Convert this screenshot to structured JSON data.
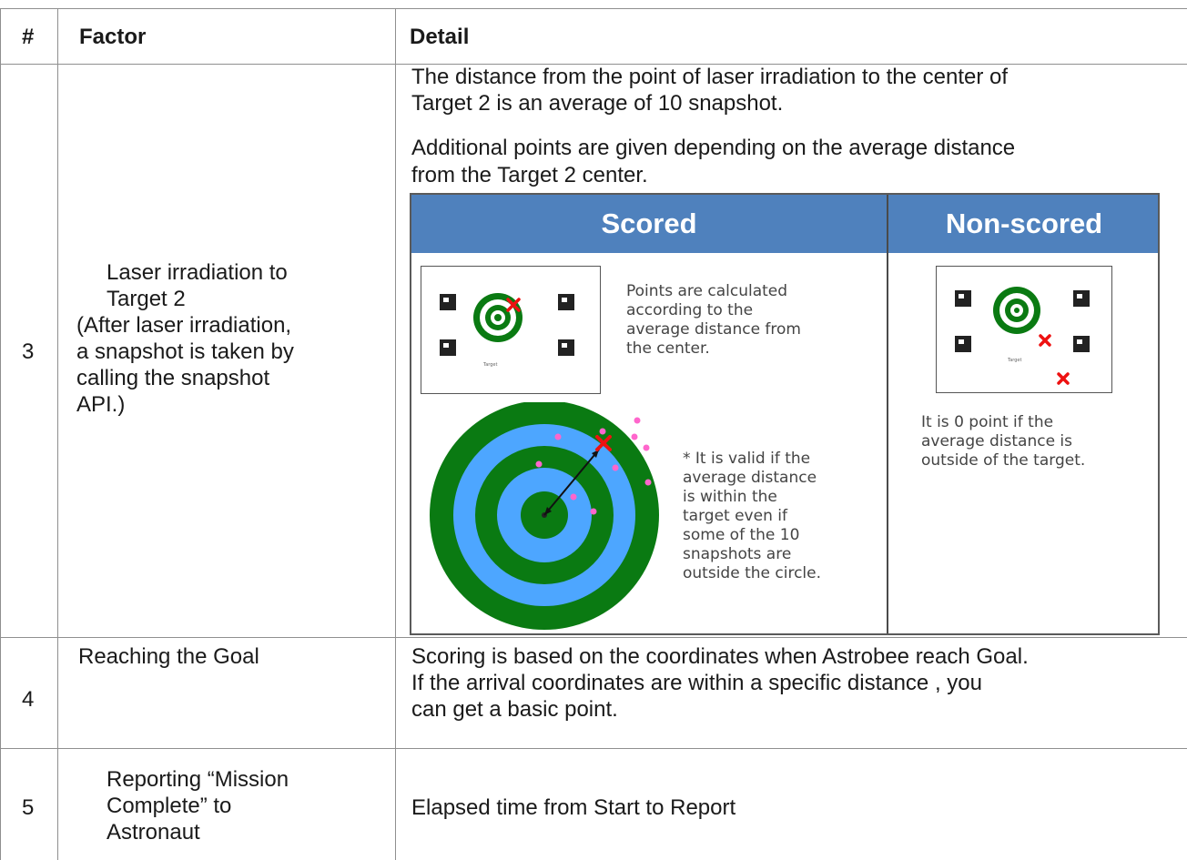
{
  "table": {
    "headers": {
      "num": "#",
      "factor": "Factor",
      "detail": "Detail"
    },
    "row3": {
      "num": "3",
      "factor_lines": [
        "Laser irradiation to",
        "Target 2",
        "(After laser irradiation,",
        "a snapshot is taken by",
        "calling the snapshot",
        "API.)"
      ],
      "detail_lines": [
        "The distance from the point of laser irradiation to the center of",
        "Target 2 is an average of 10 snapshot.",
        "Additional points are given depending on the average distance",
        "from the Target 2 center."
      ]
    },
    "row4": {
      "num": "4",
      "factor": "Reaching the Goal",
      "detail_lines": [
        "Scoring is based on the coordinates when Astrobee reach Goal.",
        "If the arrival coordinates are within a  specific distance , you",
        "can get a basic point."
      ]
    },
    "row5": {
      "num": "5",
      "factor_lines": [
        "Reporting “Mission",
        "Complete” to",
        "Astronaut"
      ],
      "detail": "Elapsed time from Start to Report"
    }
  },
  "figure": {
    "scored_header": "Scored",
    "nonscored_header": "Non-scored",
    "scored_text": [
      "Points are calculated",
      "according to the",
      "average distance from",
      "the center."
    ],
    "valid_note": [
      "* It is valid if the",
      "average distance",
      "is within the",
      "target even if",
      "some of the 10",
      "snapshots are",
      "outside the circle."
    ],
    "nonscored_text": [
      "It is 0 point if the",
      "average distance is",
      "outside of the target."
    ],
    "colors": {
      "header_blue": "#4f81bd",
      "ring_green": "#0a7a12",
      "ring_blue": "#4da6ff",
      "dot_pink": "#ff66cc",
      "cross_red": "#ee1111"
    }
  }
}
